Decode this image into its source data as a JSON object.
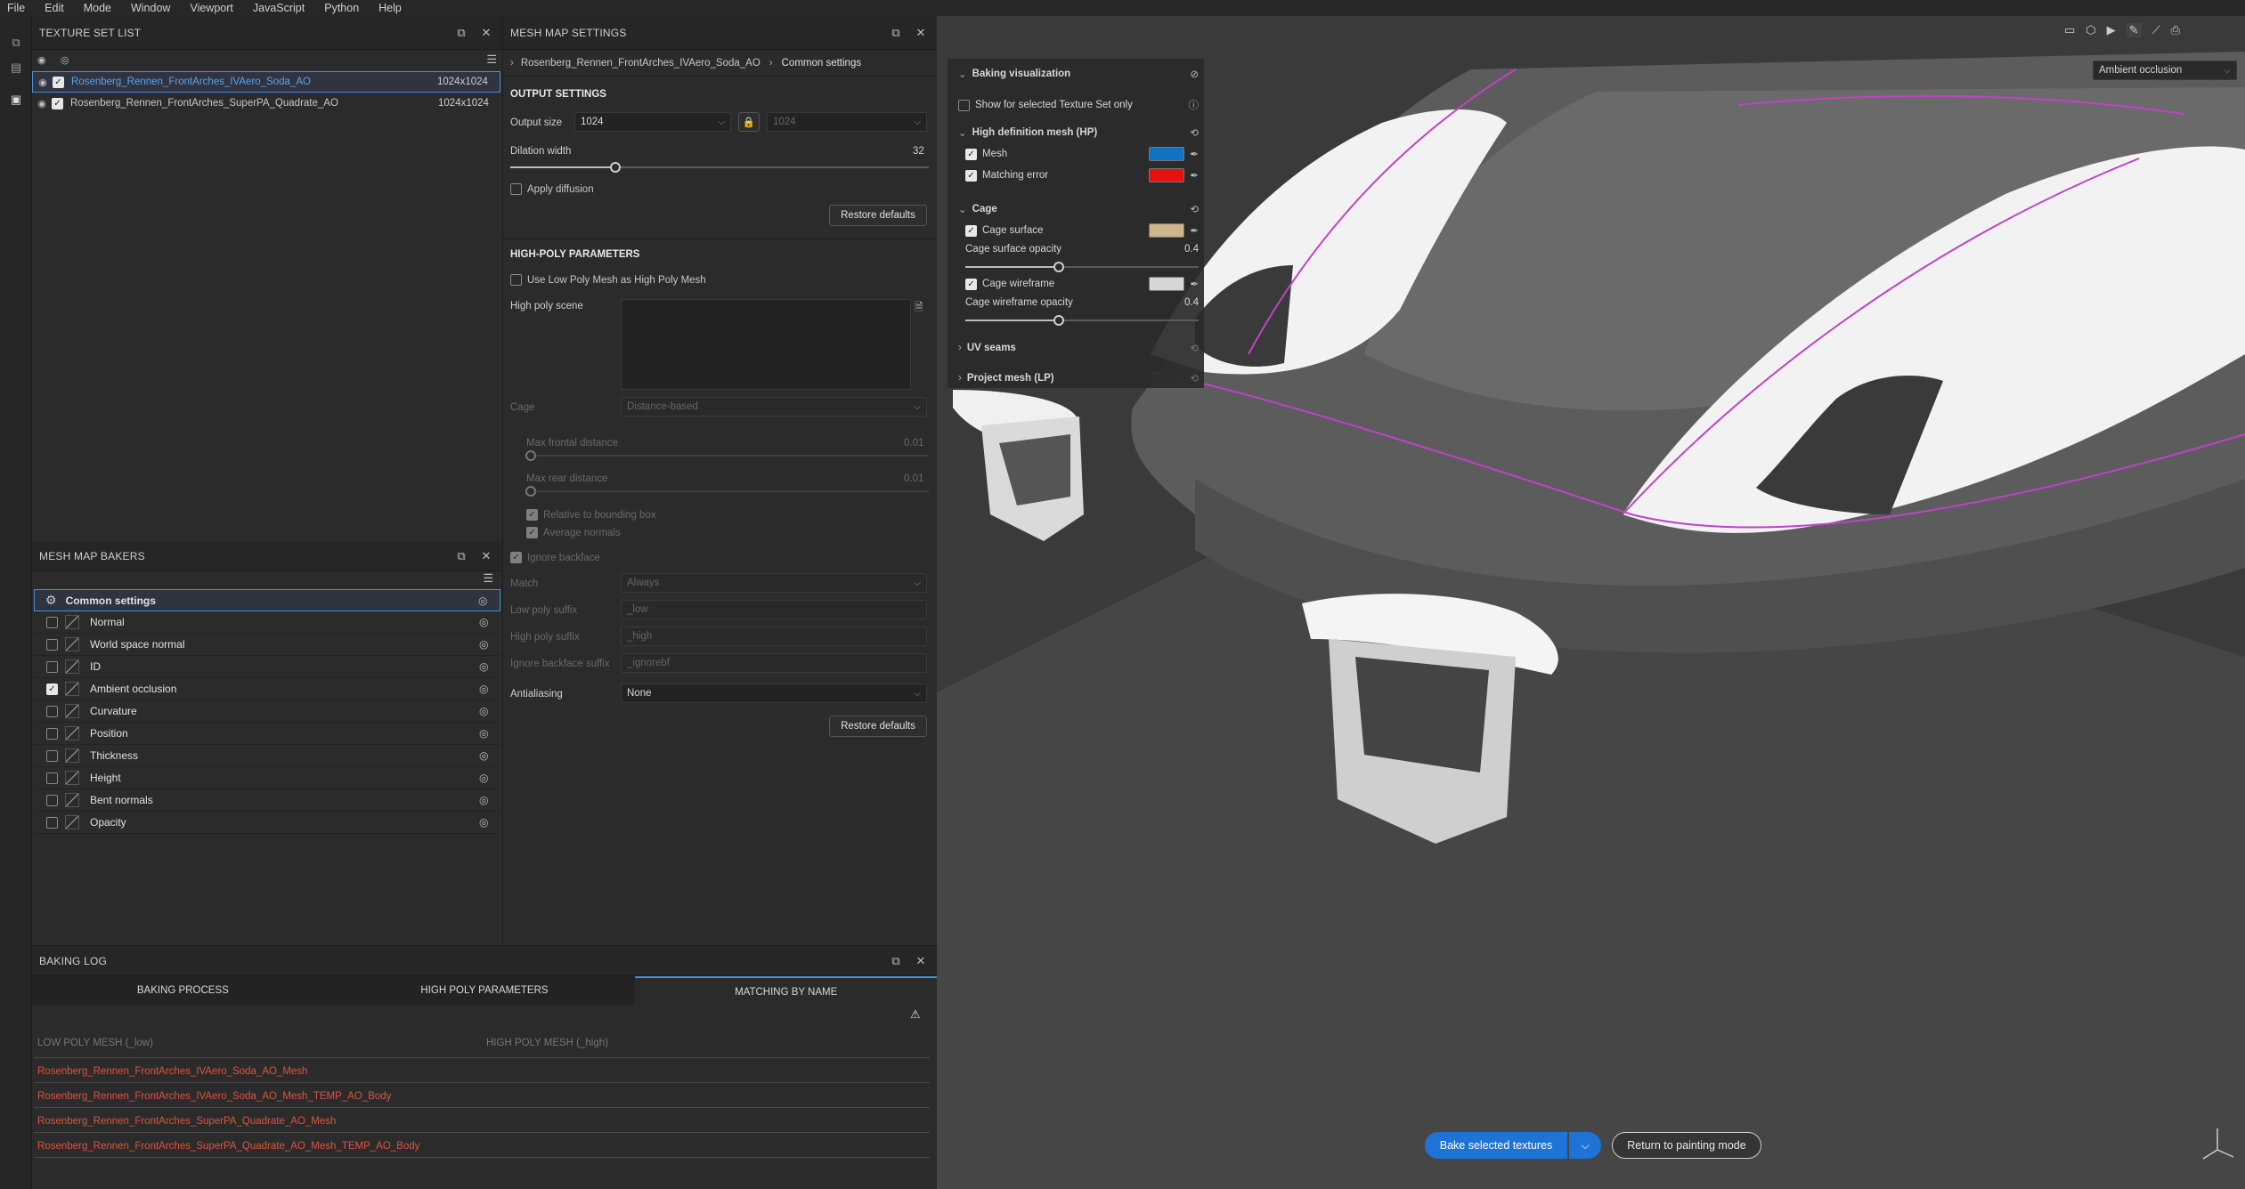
{
  "menu": [
    "File",
    "Edit",
    "Mode",
    "Window",
    "Viewport",
    "JavaScript",
    "Python",
    "Help"
  ],
  "texture_set_list": {
    "title": "TEXTURE SET LIST",
    "rows": [
      {
        "name": "Rosenberg_Rennen_FrontArches_IVAero_Soda_AO",
        "res": "1024x1024",
        "selected": true
      },
      {
        "name": "Rosenberg_Rennen_FrontArches_SuperPA_Quadrate_AO",
        "res": "1024x1024",
        "selected": false
      }
    ]
  },
  "mesh_map_bakers": {
    "title": "MESH MAP BAKERS",
    "common": "Common settings",
    "items": [
      {
        "label": "Normal",
        "checked": false
      },
      {
        "label": "World space normal",
        "checked": false
      },
      {
        "label": "ID",
        "checked": false
      },
      {
        "label": "Ambient occlusion",
        "checked": true
      },
      {
        "label": "Curvature",
        "checked": false
      },
      {
        "label": "Position",
        "checked": false
      },
      {
        "label": "Thickness",
        "checked": false
      },
      {
        "label": "Height",
        "checked": false
      },
      {
        "label": "Bent normals",
        "checked": false
      },
      {
        "label": "Opacity",
        "checked": false
      }
    ]
  },
  "mesh_map_settings": {
    "title": "MESH MAP SETTINGS",
    "breadcrumb": [
      "Rosenberg_Rennen_FrontArches_IVAero_Soda_AO",
      "Common settings"
    ],
    "output_settings": "OUTPUT SETTINGS",
    "output_size_label": "Output size",
    "output_size": "1024",
    "output_size_locked": "1024",
    "dilation_label": "Dilation width",
    "dilation_value": "32",
    "dilation_fraction": 0.25,
    "apply_diffusion": "Apply diffusion",
    "restore_defaults": "Restore defaults",
    "high_poly_params": "HIGH-POLY PARAMETERS",
    "use_low_poly": "Use Low Poly Mesh as High Poly Mesh",
    "high_poly_scene": "High poly scene",
    "cage_label": "Cage",
    "cage_value": "Distance-based",
    "max_frontal": "Max frontal distance",
    "max_frontal_value": "0.01",
    "max_rear": "Max rear distance",
    "max_rear_value": "0.01",
    "relative_bbox": "Relative to bounding box",
    "average_normals": "Average normals",
    "ignore_backface": "Ignore backface",
    "match_label": "Match",
    "match_value": "Always",
    "low_suffix_label": "Low poly suffix",
    "low_suffix": "_low",
    "high_suffix_label": "High poly suffix",
    "high_suffix": "_high",
    "ignore_suffix_label": "Ignore backface suffix",
    "ignore_suffix": "_ignorebf",
    "antialiasing_label": "Antialiasing",
    "antialiasing_value": "None"
  },
  "baking_log": {
    "title": "BAKING LOG",
    "tabs": [
      "BAKING PROCESS",
      "HIGH POLY PARAMETERS",
      "MATCHING BY NAME"
    ],
    "col_low": "LOW POLY MESH (_low)",
    "col_high": "HIGH POLY MESH (_high)",
    "errors": [
      "Rosenberg_Rennen_FrontArches_IVAero_Soda_AO_Mesh",
      "Rosenberg_Rennen_FrontArches_IVAero_Soda_AO_Mesh_TEMP_AO_Body",
      "Rosenberg_Rennen_FrontArches_SuperPA_Quadrate_AO_Mesh",
      "Rosenberg_Rennen_FrontArches_SuperPA_Quadrate_AO_Mesh_TEMP_AO_Body"
    ]
  },
  "viewport": {
    "channel": "Ambient occlusion",
    "baking_visualization": "Baking visualization",
    "show_selected": "Show for selected Texture Set only",
    "hp_section": "High definition mesh (HP)",
    "mesh": "Mesh",
    "mesh_color": "#1172c4",
    "matching_error": "Matching error",
    "matching_color": "#e61010",
    "cage": "Cage",
    "cage_surface": "Cage surface",
    "cage_surface_color": "#cfb58a",
    "cage_surface_opacity": "Cage surface opacity",
    "cage_surface_opacity_value": "0.4",
    "cage_wireframe": "Cage wireframe",
    "cage_wireframe_color": "#d6d6d6",
    "cage_wireframe_opacity": "Cage wireframe opacity",
    "cage_wireframe_opacity_value": "0.4",
    "uv_seams": "UV seams",
    "project_mesh": "Project mesh (LP)",
    "bake_button": "Bake selected textures",
    "return_button": "Return to painting mode"
  }
}
